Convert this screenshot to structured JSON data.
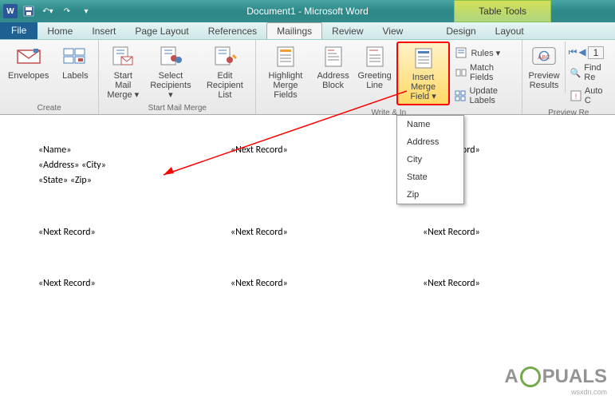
{
  "titlebar": {
    "title": "Document1 - Microsoft Word",
    "table_tools": "Table Tools"
  },
  "tabs": {
    "file": "File",
    "home": "Home",
    "insert": "Insert",
    "page_layout": "Page Layout",
    "references": "References",
    "mailings": "Mailings",
    "review": "Review",
    "view": "View",
    "design": "Design",
    "layout": "Layout"
  },
  "ribbon": {
    "create": {
      "label": "Create",
      "envelopes": "Envelopes",
      "labels": "Labels"
    },
    "start": {
      "label": "Start Mail Merge",
      "start_merge": "Start Mail\nMerge ▾",
      "select_recipients": "Select\nRecipients ▾",
      "edit_list": "Edit\nRecipient List"
    },
    "write": {
      "label": "Write & In",
      "highlight": "Highlight\nMerge Fields",
      "address": "Address\nBlock",
      "greeting": "Greeting\nLine",
      "insert_field": "Insert Merge\nField ▾",
      "rules": "Rules ▾",
      "match": "Match Fields",
      "update": "Update Labels"
    },
    "preview": {
      "label": "Preview Re",
      "results": "Preview\nResults",
      "find": "Find Re",
      "auto": "Auto C"
    }
  },
  "dropdown": {
    "items": [
      "Name",
      "Address",
      "City",
      "State",
      "Zip"
    ]
  },
  "document": {
    "cells": [
      "«Name»\n«Address» «City»\n«State» «Zip»",
      "«Next Record»",
      "«Next Record»",
      "«Next Record»",
      "«Next Record»",
      "«Next Record»",
      "«Next Record»",
      "«Next Record»",
      "«Next Record»"
    ]
  },
  "watermark": {
    "text_a": "A",
    "text_b": "PUALS",
    "site": "wsxdn.com"
  }
}
